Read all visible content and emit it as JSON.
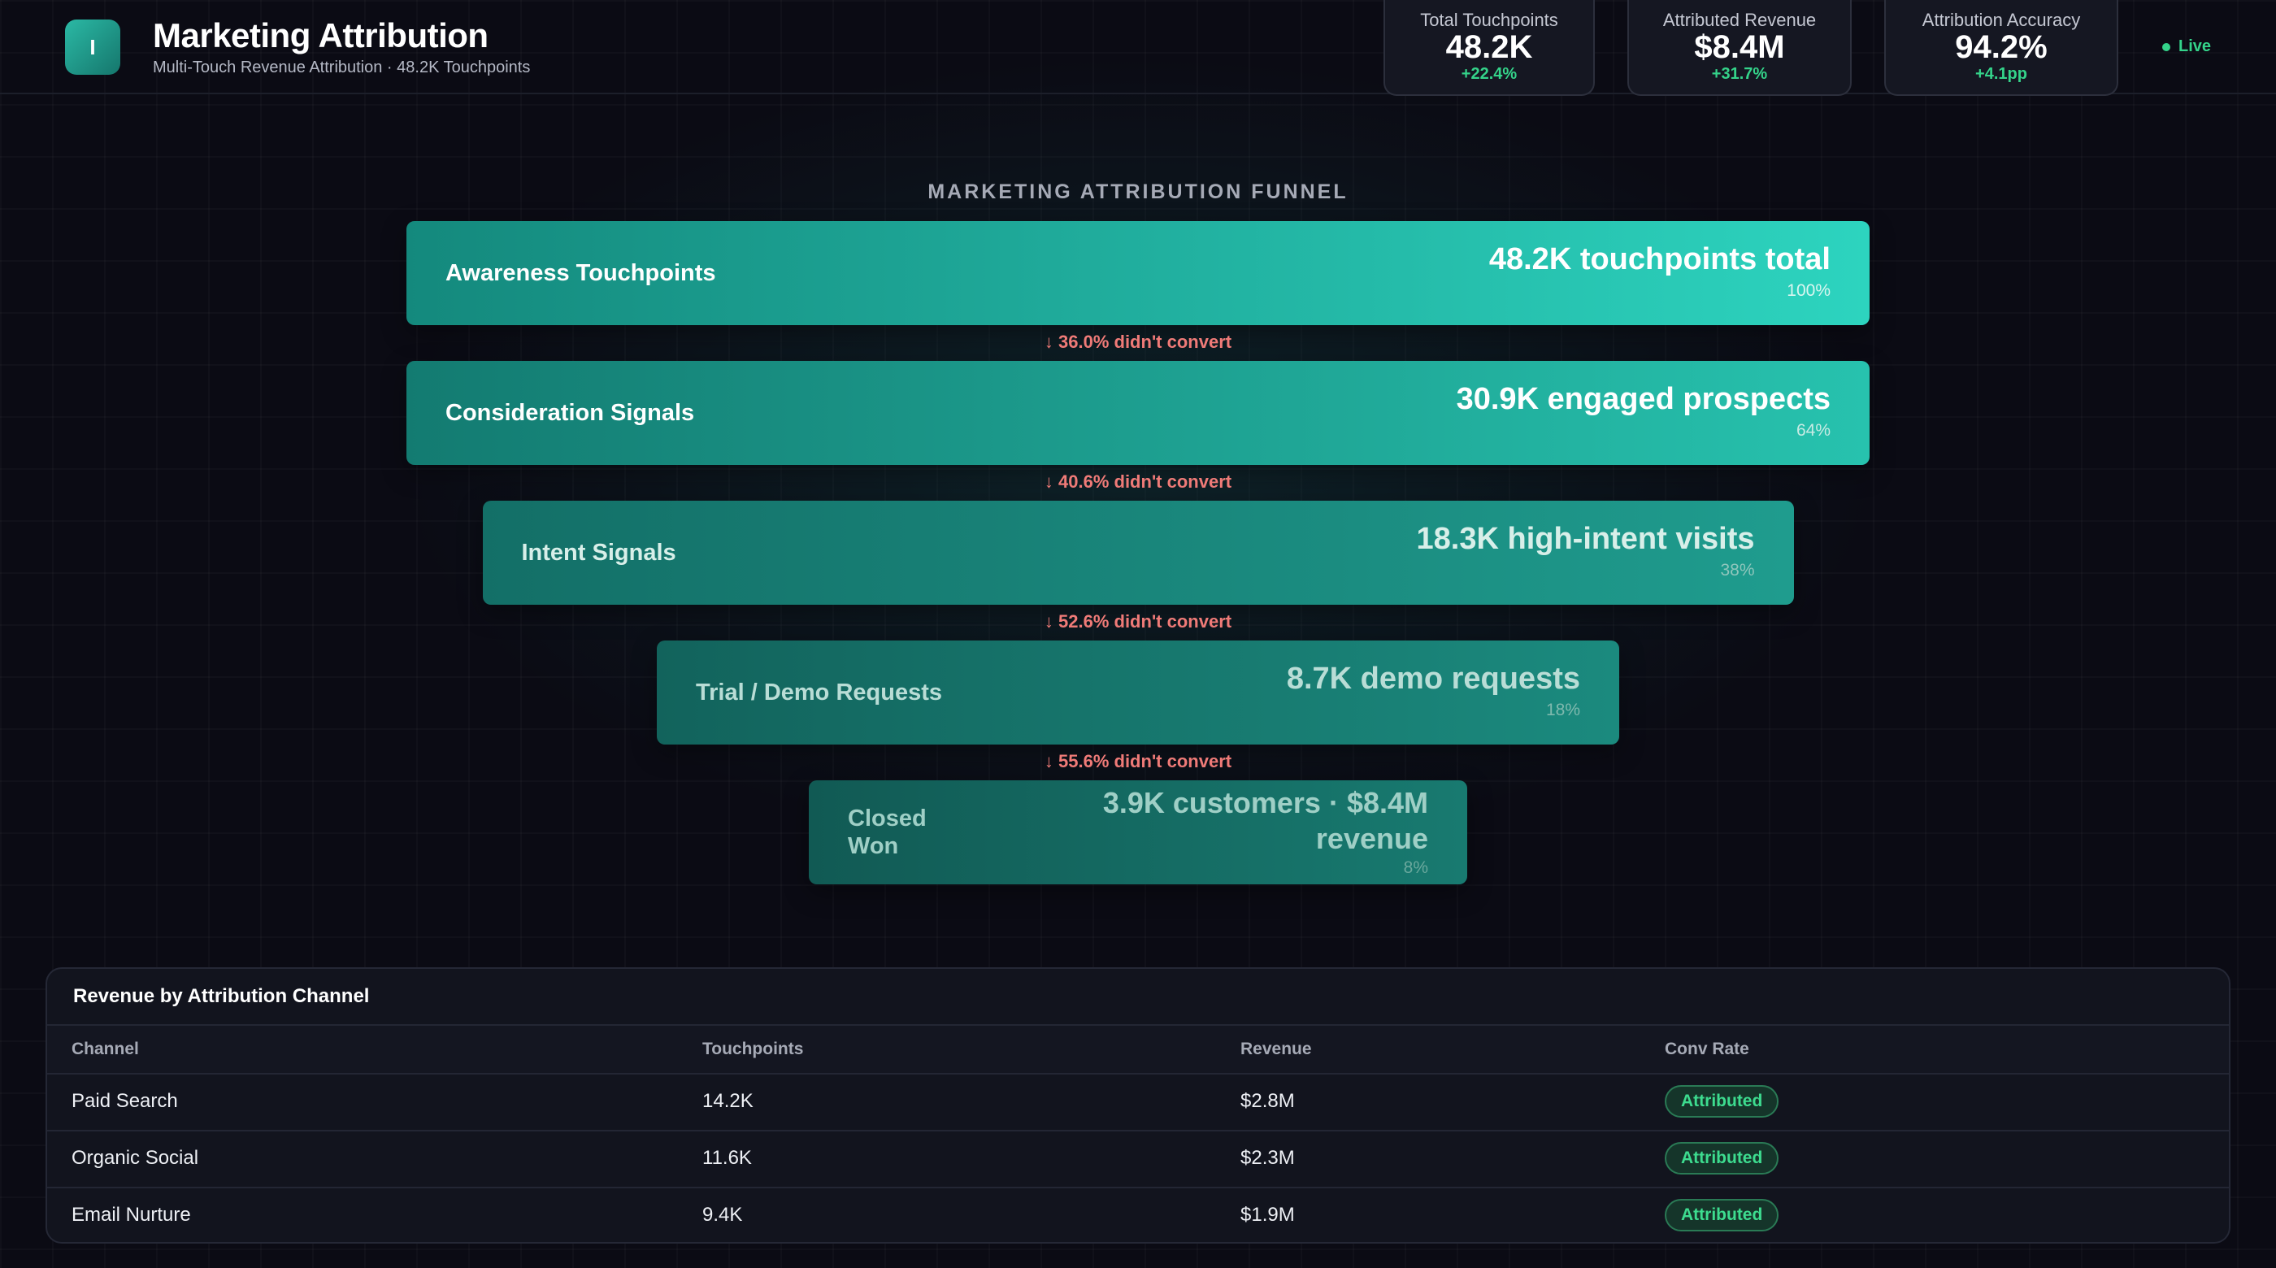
{
  "header": {
    "icon_letter": "I",
    "title": "Marketing Attribution",
    "subtitle": "Multi-Touch Revenue Attribution · 48.2K Touchpoints",
    "live_label": "Live"
  },
  "kpis": [
    {
      "label": "Total Touchpoints",
      "value": "48.2K",
      "delta": "+22.4%"
    },
    {
      "label": "Attributed Revenue",
      "value": "$8.4M",
      "delta": "+31.7%"
    },
    {
      "label": "Attribution Accuracy",
      "value": "94.2%",
      "delta": "+4.1pp"
    }
  ],
  "funnel": {
    "title": "MARKETING ATTRIBUTION FUNNEL",
    "stages": [
      {
        "name": "Awareness Touchpoints",
        "value": "48.2K touchpoints total",
        "pct": "100%",
        "fraction": 1.0,
        "color_from": "#14897d",
        "color_to": "#2dd4bf"
      },
      {
        "name": "Consideration Signals",
        "value": "30.9K engaged prospects",
        "pct": "64%",
        "fraction": 1.0,
        "color_from": "#137b71",
        "color_to": "#27c2ae"
      },
      {
        "name": "Intent Signals",
        "value": "18.3K high-intent visits",
        "pct": "38%",
        "fraction": 0.896,
        "color_from": "#136f67",
        "color_to": "#1f9c8e"
      },
      {
        "name": "Trial / Demo Requests",
        "value": "8.7K demo requests",
        "pct": "18%",
        "fraction": 0.658,
        "color_from": "#12635c",
        "color_to": "#1b8a7e"
      },
      {
        "name": "Closed Won",
        "value": "3.9K customers · $8.4M revenue",
        "pct": "8%",
        "fraction": 0.45,
        "color_from": "#115a54",
        "color_to": "#187a70"
      }
    ],
    "dropoffs": [
      "↓ 36.0% didn't convert",
      "↓ 40.6% didn't convert",
      "↓ 52.6% didn't convert",
      "↓ 55.6% didn't convert"
    ]
  },
  "table": {
    "title": "Revenue by Attribution Channel",
    "columns": [
      "Channel",
      "Touchpoints",
      "Revenue",
      "Conv Rate"
    ],
    "rows": [
      {
        "channel": "Paid Search",
        "touchpoints": "14.2K",
        "revenue": "$2.8M",
        "status": "Attributed"
      },
      {
        "channel": "Organic Social",
        "touchpoints": "11.6K",
        "revenue": "$2.3M",
        "status": "Attributed"
      },
      {
        "channel": "Email Nurture",
        "touchpoints": "9.4K",
        "revenue": "$1.9M",
        "status": "Attributed"
      }
    ]
  }
}
